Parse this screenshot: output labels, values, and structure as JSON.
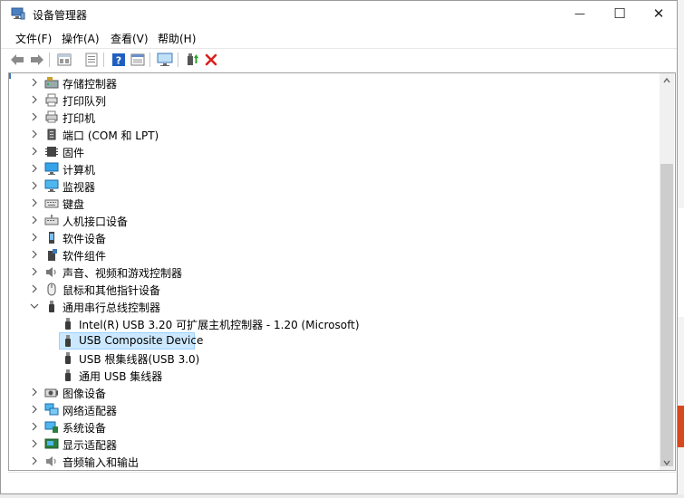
{
  "window": {
    "title": "设备管理器",
    "controls": {
      "minimize": "—",
      "maximize": "☐",
      "close": "✕"
    }
  },
  "menu": [
    {
      "label": "文件(F)"
    },
    {
      "label": "操作(A)"
    },
    {
      "label": "查看(V)"
    },
    {
      "label": "帮助(H)"
    }
  ],
  "toolbar": {
    "buttons": [
      "back-icon",
      "forward-icon",
      "properties-icon",
      "driver-icon",
      "help-icon",
      "view-icon",
      "monitor-icon",
      "add-driver-icon",
      "uninstall-icon"
    ]
  },
  "tree": {
    "items": [
      {
        "label": "存储控制器",
        "icon": "storage-controller-icon",
        "expanded": false
      },
      {
        "label": "打印队列",
        "icon": "print-queue-icon",
        "expanded": false
      },
      {
        "label": "打印机",
        "icon": "printer-icon",
        "expanded": false
      },
      {
        "label": "端口 (COM 和 LPT)",
        "icon": "port-icon",
        "expanded": false
      },
      {
        "label": "固件",
        "icon": "firmware-icon",
        "expanded": false
      },
      {
        "label": "计算机",
        "icon": "computer-icon",
        "expanded": false
      },
      {
        "label": "监视器",
        "icon": "monitor-icon",
        "expanded": false
      },
      {
        "label": "键盘",
        "icon": "keyboard-icon",
        "expanded": false
      },
      {
        "label": "人机接口设备",
        "icon": "hid-icon",
        "expanded": false
      },
      {
        "label": "软件设备",
        "icon": "software-device-icon",
        "expanded": false
      },
      {
        "label": "软件组件",
        "icon": "software-component-icon",
        "expanded": false
      },
      {
        "label": "声音、视频和游戏控制器",
        "icon": "sound-icon",
        "expanded": false
      },
      {
        "label": "鼠标和其他指针设备",
        "icon": "mouse-icon",
        "expanded": false
      },
      {
        "label": "通用串行总线控制器",
        "icon": "usb-icon",
        "expanded": true
      },
      {
        "label": "Intel(R) USB 3.20 可扩展主机控制器 - 1.20 (Microsoft)",
        "icon": "usb-icon",
        "child": true
      },
      {
        "label": "USB Composite Device",
        "icon": "usb-icon",
        "child": true,
        "selected": true
      },
      {
        "label": "USB 根集线器(USB 3.0)",
        "icon": "usb-icon",
        "child": true
      },
      {
        "label": "通用 USB 集线器",
        "icon": "usb-icon",
        "child": true
      },
      {
        "label": "图像设备",
        "icon": "camera-icon",
        "expanded": false
      },
      {
        "label": "网络适配器",
        "icon": "network-icon",
        "expanded": false
      },
      {
        "label": "系统设备",
        "icon": "system-device-icon",
        "expanded": false
      },
      {
        "label": "显示适配器",
        "icon": "display-adapter-icon",
        "expanded": false
      },
      {
        "label": "音频输入和输出",
        "icon": "audio-io-icon",
        "expanded": false
      }
    ]
  },
  "colors": {
    "selection": "#cce8ff",
    "selection_border": "#99d1ff",
    "delete": "#d9201b",
    "help": "#1f5fbf"
  }
}
